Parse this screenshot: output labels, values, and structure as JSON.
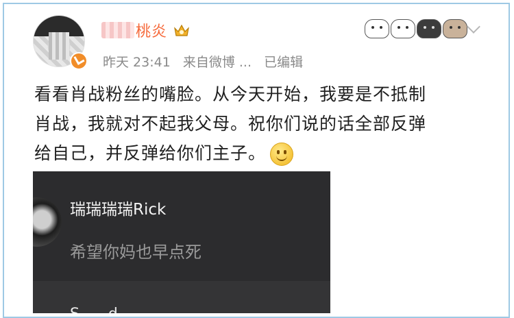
{
  "post": {
    "author_visible": "桃炎",
    "timestamp": "昨天 23:41",
    "source": "来自微博 ...",
    "edited": "已编辑",
    "lines": [
      "看看肖战粉丝的嘴脸。从今天开始，我要是不抵制",
      "肖战，我就对不起我父母。祝你们说的话全部反弹",
      "给自己，并反弹给你们主子。"
    ]
  },
  "embedded_comment": {
    "name": "瑞瑞瑞瑞Rick",
    "text": "希望你妈也早点死",
    "next_name_partial": "S......d......"
  },
  "icons": {
    "verified": "verified-badge-icon",
    "crown": "crown-icon",
    "emoji": "smile-emoji-icon",
    "chevron": "chevron-down-icon"
  },
  "colors": {
    "frame": "#9ec9e4",
    "username": "#f6693a",
    "meta": "#8a8a8a",
    "comment_bg": "#2c2c2e"
  }
}
